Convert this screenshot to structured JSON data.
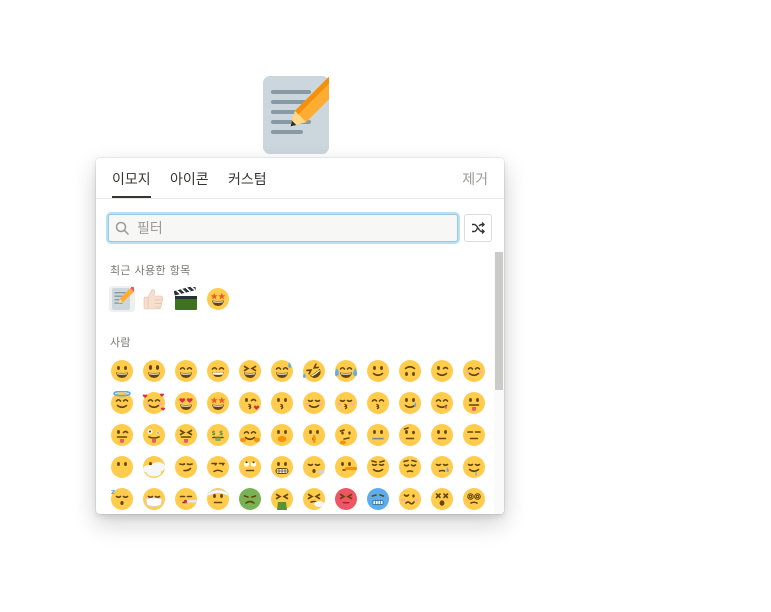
{
  "page": {
    "icon": "memo-pencil-icon"
  },
  "picker": {
    "tabs": [
      {
        "label": "이모지",
        "active": true
      },
      {
        "label": "아이콘",
        "active": false
      },
      {
        "label": "커스텀",
        "active": false
      }
    ],
    "remove_label": "제거",
    "search": {
      "placeholder": "필터",
      "value": ""
    },
    "shuffle_icon": "shuffle-icon",
    "recent": {
      "label": "최근 사용한 항목",
      "items": [
        "memo-emoji",
        "thumbs-up-light-skin-emoji",
        "clapper-board-emoji",
        "star-struck-emoji"
      ]
    },
    "people": {
      "label": "사람",
      "rows": [
        [
          "grinning-face",
          "grinning-face-big-eyes",
          "grinning-smiling-eyes",
          "beaming-face",
          "grinning-squinting",
          "grinning-sweat",
          "rofl",
          "tears-of-joy",
          "slightly-smiling",
          "upside-down",
          "winking",
          "smiling-eyes"
        ],
        [
          "halo",
          "smiling-hearts",
          "heart-eyes",
          "star-struck",
          "face-blowing-kiss",
          "kissing",
          "smiling-relaxed",
          "kissing-closed-eyes",
          "kissing-smiling-eyes",
          "smiling-tear",
          "savoring-food",
          "tongue-out"
        ],
        [
          "winking-tongue",
          "zany",
          "squinting-tongue",
          "money-mouth",
          "hugging",
          "hand-over-mouth",
          "shushing",
          "thinking",
          "zipper-mouth",
          "raised-eyebrow",
          "neutral",
          "expressionless"
        ],
        [
          "no-mouth",
          "face-in-clouds",
          "smirking",
          "unamused",
          "rolling-eyes",
          "grimacing",
          "exhaling",
          "lying",
          "relieved",
          "pensive",
          "sleepy",
          "drooling"
        ],
        [
          "sleeping",
          "medical-mask",
          "thermometer",
          "head-bandage",
          "nauseated",
          "vomiting",
          "sneezing",
          "hot-face",
          "cold-face",
          "woozy",
          "dizzy",
          "spiral-eyes"
        ]
      ]
    }
  },
  "colors": {
    "accent": "#2eaadc",
    "face": "#FFCC4D",
    "feature": "#664500",
    "text_muted": "#9b9a97"
  }
}
